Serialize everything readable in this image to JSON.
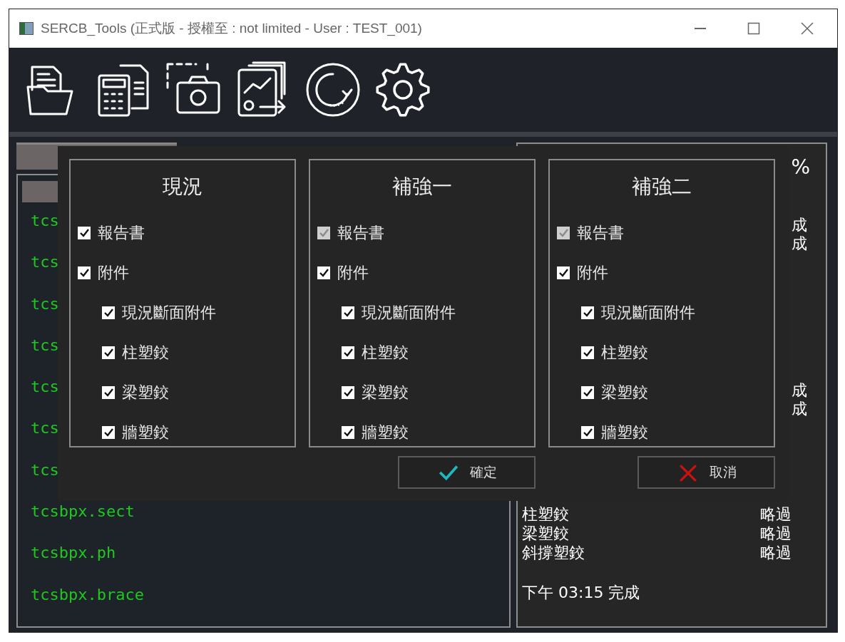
{
  "window": {
    "title": "SERCB_Tools (正式版 - 授權至 : not limited -  User : TEST_001)"
  },
  "toolbar": [
    {
      "kind": "open"
    },
    {
      "kind": "calc"
    },
    {
      "kind": "capture"
    },
    {
      "kind": "export"
    },
    {
      "kind": "refresh"
    },
    {
      "kind": "settings"
    }
  ],
  "file_list": [
    "tcs",
    "tcs",
    "tcs",
    "tcs",
    "tcs",
    "tcs",
    "tcs",
    "tcsbpx.sect",
    "tcsbpx.ph",
    "tcsbpx.brace"
  ],
  "log_panel": {
    "percent": "%",
    "status_marks": [
      [
        "成",
        "成"
      ],
      [
        "成",
        "成"
      ]
    ],
    "rows": [
      {
        "label": "柱塑鉸",
        "status": "略過"
      },
      {
        "label": "梁塑鉸",
        "status": "略過"
      },
      {
        "label": "斜撐塑鉸",
        "status": "略過"
      }
    ],
    "footer": "下午 03:15 完成"
  },
  "dialog": {
    "groups": [
      {
        "title": "現況",
        "items": [
          {
            "label": "報告書",
            "checked": true,
            "disabled": false
          },
          {
            "label": "附件",
            "checked": true,
            "disabled": false,
            "children": [
              {
                "label": "現況斷面附件",
                "checked": true,
                "disabled": false
              },
              {
                "label": "柱塑鉸",
                "checked": true,
                "disabled": false
              },
              {
                "label": "梁塑鉸",
                "checked": true,
                "disabled": false
              },
              {
                "label": "牆塑鉸",
                "checked": true,
                "disabled": false
              }
            ]
          }
        ]
      },
      {
        "title": "補強一",
        "items": [
          {
            "label": "報告書",
            "checked": true,
            "disabled": true
          },
          {
            "label": "附件",
            "checked": true,
            "disabled": false,
            "children": [
              {
                "label": "現況斷面附件",
                "checked": true,
                "disabled": false
              },
              {
                "label": "柱塑鉸",
                "checked": true,
                "disabled": false
              },
              {
                "label": "梁塑鉸",
                "checked": true,
                "disabled": false
              },
              {
                "label": "牆塑鉸",
                "checked": true,
                "disabled": false
              }
            ]
          }
        ]
      },
      {
        "title": "補強二",
        "items": [
          {
            "label": "報告書",
            "checked": true,
            "disabled": true
          },
          {
            "label": "附件",
            "checked": true,
            "disabled": false,
            "children": [
              {
                "label": "現況斷面附件",
                "checked": true,
                "disabled": false
              },
              {
                "label": "柱塑鉸",
                "checked": true,
                "disabled": false
              },
              {
                "label": "梁塑鉸",
                "checked": true,
                "disabled": false
              },
              {
                "label": "牆塑鉸",
                "checked": true,
                "disabled": false
              }
            ]
          }
        ]
      }
    ],
    "buttons": [
      {
        "kind": "ok",
        "label": "確定"
      },
      {
        "kind": "cancel",
        "label": "取消"
      }
    ]
  }
}
